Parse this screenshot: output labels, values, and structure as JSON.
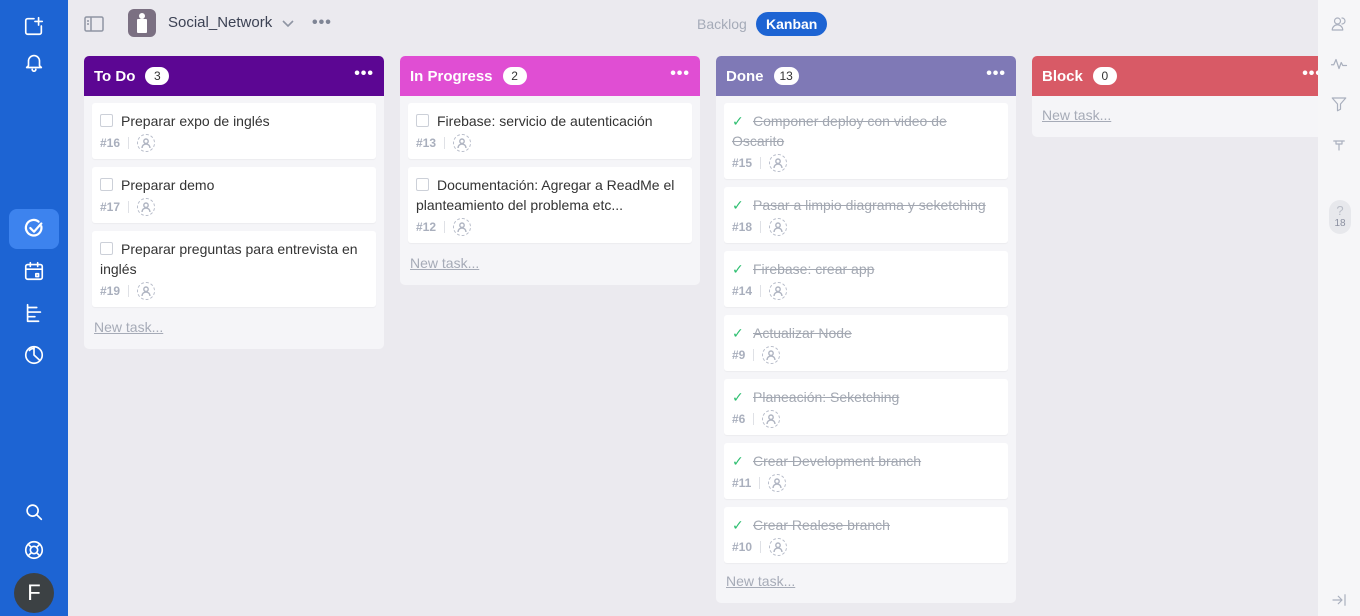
{
  "header": {
    "project_name": "Social_Network",
    "views": [
      "Backlog",
      "Kanban"
    ],
    "active_view": "Kanban"
  },
  "user": {
    "initial": "F"
  },
  "right_panel": {
    "help_count": "18"
  },
  "new_task_label": "New task...",
  "columns": [
    {
      "title": "To Do",
      "count": "3",
      "color": "#5c0693",
      "tasks": [
        {
          "title": "Preparar expo de inglés",
          "id": "#16",
          "done": false
        },
        {
          "title": "Preparar demo",
          "id": "#17",
          "done": false
        },
        {
          "title": "Preparar preguntas para entrevista en inglés",
          "id": "#19",
          "done": false
        }
      ]
    },
    {
      "title": "In Progress",
      "count": "2",
      "color": "#e04ed3",
      "tasks": [
        {
          "title": "Firebase: servicio de autenticación",
          "id": "#13",
          "done": false
        },
        {
          "title": "Documentación: Agregar a ReadMe el planteamiento del problema etc...",
          "id": "#12",
          "done": false
        }
      ]
    },
    {
      "title": "Done",
      "count": "13",
      "color": "#7f79b6",
      "tasks": [
        {
          "title": "Componer deploy con video de Oscarito",
          "id": "#15",
          "done": true
        },
        {
          "title": "Pasar a limpio diagrama y seketching",
          "id": "#18",
          "done": true
        },
        {
          "title": "Firebase: crear app",
          "id": "#14",
          "done": true
        },
        {
          "title": "Actualizar Node",
          "id": "#9",
          "done": true
        },
        {
          "title": "Planeación: Seketching",
          "id": "#6",
          "done": true
        },
        {
          "title": "Crear Development branch",
          "id": "#11",
          "done": true
        },
        {
          "title": "Crear Realese branch",
          "id": "#10",
          "done": true
        }
      ]
    },
    {
      "title": "Block",
      "count": "0",
      "color": "#d85a66",
      "tasks": []
    }
  ]
}
